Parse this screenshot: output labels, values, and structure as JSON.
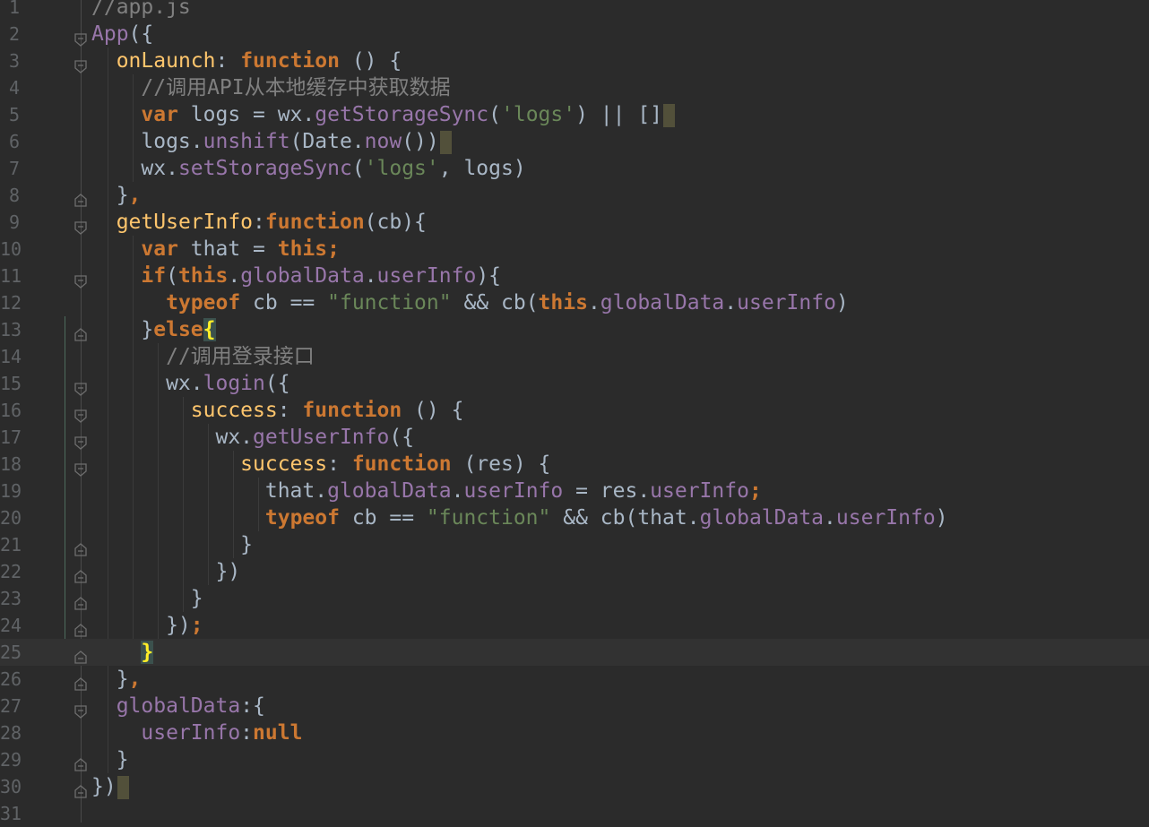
{
  "editor": {
    "language": "javascript",
    "theme_colors": {
      "background": "#2b2b2b",
      "keyword": "#cc7832",
      "function_name": "#ffc66d",
      "property": "#9876aa",
      "string": "#6a8759",
      "comment": "#808080",
      "text": "#a9b7c6",
      "line_number": "#606366",
      "brace_highlight": "#ffef28"
    },
    "current_line": 25,
    "lines": [
      {
        "n": "1",
        "fold": "",
        "tokens": [
          {
            "c": "com",
            "t": "//app.js"
          }
        ]
      },
      {
        "n": "2",
        "fold": "open",
        "tokens": [
          {
            "c": "app",
            "t": "App"
          },
          {
            "c": "plain",
            "t": "({"
          }
        ]
      },
      {
        "n": "3",
        "fold": "open",
        "tokens": [
          {
            "c": "plain",
            "t": "  "
          },
          {
            "c": "fn",
            "t": "onLaunch"
          },
          {
            "c": "plain",
            "t": ": "
          },
          {
            "c": "kw",
            "t": "function"
          },
          {
            "c": "plain",
            "t": " () {"
          }
        ]
      },
      {
        "n": "4",
        "fold": "",
        "tokens": [
          {
            "c": "plain",
            "t": "    "
          },
          {
            "c": "com",
            "t": "//调用API从本地缓存中获取数据"
          }
        ]
      },
      {
        "n": "5",
        "fold": "",
        "tokens": [
          {
            "c": "plain",
            "t": "    "
          },
          {
            "c": "kw",
            "t": "var"
          },
          {
            "c": "plain",
            "t": " logs = wx."
          },
          {
            "c": "prop",
            "t": "getStorageSync"
          },
          {
            "c": "plain",
            "t": "("
          },
          {
            "c": "str",
            "t": "'logs'"
          },
          {
            "c": "plain",
            "t": ") || []"
          },
          {
            "c": "mark",
            "t": ""
          }
        ]
      },
      {
        "n": "6",
        "fold": "",
        "tokens": [
          {
            "c": "plain",
            "t": "    logs."
          },
          {
            "c": "prop",
            "t": "unshift"
          },
          {
            "c": "plain",
            "t": "(Date."
          },
          {
            "c": "prop",
            "t": "now"
          },
          {
            "c": "plain",
            "t": "())"
          },
          {
            "c": "mark",
            "t": ""
          }
        ]
      },
      {
        "n": "7",
        "fold": "",
        "tokens": [
          {
            "c": "plain",
            "t": "    wx."
          },
          {
            "c": "prop",
            "t": "setStorageSync"
          },
          {
            "c": "plain",
            "t": "("
          },
          {
            "c": "str",
            "t": "'logs'"
          },
          {
            "c": "plain",
            "t": ", logs)"
          }
        ]
      },
      {
        "n": "8",
        "fold": "close",
        "tokens": [
          {
            "c": "plain",
            "t": "  }"
          },
          {
            "c": "kw",
            "t": ","
          }
        ]
      },
      {
        "n": "9",
        "fold": "open",
        "tokens": [
          {
            "c": "plain",
            "t": "  "
          },
          {
            "c": "fn",
            "t": "getUserInfo"
          },
          {
            "c": "plain",
            "t": ":"
          },
          {
            "c": "kw",
            "t": "function"
          },
          {
            "c": "plain",
            "t": "(cb){"
          }
        ]
      },
      {
        "n": "10",
        "fold": "",
        "tokens": [
          {
            "c": "plain",
            "t": "    "
          },
          {
            "c": "kw",
            "t": "var"
          },
          {
            "c": "plain",
            "t": " that = "
          },
          {
            "c": "kw",
            "t": "this;"
          }
        ]
      },
      {
        "n": "11",
        "fold": "open",
        "tokens": [
          {
            "c": "plain",
            "t": "    "
          },
          {
            "c": "kw",
            "t": "if"
          },
          {
            "c": "plain",
            "t": "("
          },
          {
            "c": "kw",
            "t": "this"
          },
          {
            "c": "plain",
            "t": "."
          },
          {
            "c": "prop",
            "t": "globalData"
          },
          {
            "c": "plain",
            "t": "."
          },
          {
            "c": "prop",
            "t": "userInfo"
          },
          {
            "c": "plain",
            "t": "){"
          }
        ]
      },
      {
        "n": "12",
        "fold": "",
        "tokens": [
          {
            "c": "plain",
            "t": "      "
          },
          {
            "c": "kw",
            "t": "typeof"
          },
          {
            "c": "plain",
            "t": " cb == "
          },
          {
            "c": "str",
            "t": "\"function\""
          },
          {
            "c": "plain",
            "t": " && cb("
          },
          {
            "c": "kw",
            "t": "this"
          },
          {
            "c": "plain",
            "t": "."
          },
          {
            "c": "prop",
            "t": "globalData"
          },
          {
            "c": "plain",
            "t": "."
          },
          {
            "c": "prop",
            "t": "userInfo"
          },
          {
            "c": "plain",
            "t": ")"
          }
        ]
      },
      {
        "n": "13",
        "fold": "close",
        "tokens": [
          {
            "c": "plain",
            "t": "    }"
          },
          {
            "c": "kw",
            "t": "else"
          },
          {
            "c": "brace",
            "t": "{"
          }
        ]
      },
      {
        "n": "14",
        "fold": "",
        "tokens": [
          {
            "c": "plain",
            "t": "      "
          },
          {
            "c": "com",
            "t": "//调用登录接口"
          }
        ]
      },
      {
        "n": "15",
        "fold": "open",
        "tokens": [
          {
            "c": "plain",
            "t": "      wx."
          },
          {
            "c": "prop",
            "t": "login"
          },
          {
            "c": "plain",
            "t": "({"
          }
        ]
      },
      {
        "n": "16",
        "fold": "open",
        "tokens": [
          {
            "c": "plain",
            "t": "        "
          },
          {
            "c": "fn",
            "t": "success"
          },
          {
            "c": "plain",
            "t": ": "
          },
          {
            "c": "kw",
            "t": "function"
          },
          {
            "c": "plain",
            "t": " () {"
          }
        ]
      },
      {
        "n": "17",
        "fold": "open",
        "tokens": [
          {
            "c": "plain",
            "t": "          wx."
          },
          {
            "c": "prop",
            "t": "getUserInfo"
          },
          {
            "c": "plain",
            "t": "({"
          }
        ]
      },
      {
        "n": "18",
        "fold": "open",
        "tokens": [
          {
            "c": "plain",
            "t": "            "
          },
          {
            "c": "fn",
            "t": "success"
          },
          {
            "c": "plain",
            "t": ": "
          },
          {
            "c": "kw",
            "t": "function"
          },
          {
            "c": "plain",
            "t": " (res) {"
          }
        ]
      },
      {
        "n": "19",
        "fold": "",
        "tokens": [
          {
            "c": "plain",
            "t": "              that."
          },
          {
            "c": "prop",
            "t": "globalData"
          },
          {
            "c": "plain",
            "t": "."
          },
          {
            "c": "prop",
            "t": "userInfo"
          },
          {
            "c": "plain",
            "t": " = res."
          },
          {
            "c": "prop",
            "t": "userInfo"
          },
          {
            "c": "kw",
            "t": ";"
          }
        ]
      },
      {
        "n": "20",
        "fold": "",
        "tokens": [
          {
            "c": "plain",
            "t": "              "
          },
          {
            "c": "kw",
            "t": "typeof"
          },
          {
            "c": "plain",
            "t": " cb == "
          },
          {
            "c": "str",
            "t": "\"function\""
          },
          {
            "c": "plain",
            "t": " && cb(that."
          },
          {
            "c": "prop",
            "t": "globalData"
          },
          {
            "c": "plain",
            "t": "."
          },
          {
            "c": "prop",
            "t": "userInfo"
          },
          {
            "c": "plain",
            "t": ")"
          }
        ]
      },
      {
        "n": "21",
        "fold": "close",
        "tokens": [
          {
            "c": "plain",
            "t": "            }"
          }
        ]
      },
      {
        "n": "22",
        "fold": "close",
        "tokens": [
          {
            "c": "plain",
            "t": "          })"
          }
        ]
      },
      {
        "n": "23",
        "fold": "close",
        "tokens": [
          {
            "c": "plain",
            "t": "        }"
          }
        ]
      },
      {
        "n": "24",
        "fold": "close",
        "tokens": [
          {
            "c": "plain",
            "t": "      })"
          },
          {
            "c": "kw",
            "t": ";"
          }
        ]
      },
      {
        "n": "25",
        "fold": "close",
        "tokens": [
          {
            "c": "plain",
            "t": "    "
          },
          {
            "c": "brace",
            "t": "}"
          }
        ]
      },
      {
        "n": "26",
        "fold": "close",
        "tokens": [
          {
            "c": "plain",
            "t": "  }"
          },
          {
            "c": "kw",
            "t": ","
          }
        ]
      },
      {
        "n": "27",
        "fold": "open",
        "tokens": [
          {
            "c": "plain",
            "t": "  "
          },
          {
            "c": "prop",
            "t": "globalData"
          },
          {
            "c": "plain",
            "t": ":{"
          }
        ]
      },
      {
        "n": "28",
        "fold": "",
        "tokens": [
          {
            "c": "plain",
            "t": "    "
          },
          {
            "c": "prop",
            "t": "userInfo"
          },
          {
            "c": "plain",
            "t": ":"
          },
          {
            "c": "kw",
            "t": "null"
          }
        ]
      },
      {
        "n": "29",
        "fold": "close",
        "tokens": [
          {
            "c": "plain",
            "t": "  }"
          }
        ]
      },
      {
        "n": "30",
        "fold": "close",
        "tokens": [
          {
            "c": "plain",
            "t": "})"
          },
          {
            "c": "mark",
            "t": ""
          }
        ]
      },
      {
        "n": "31",
        "fold": "",
        "tokens": []
      }
    ]
  }
}
